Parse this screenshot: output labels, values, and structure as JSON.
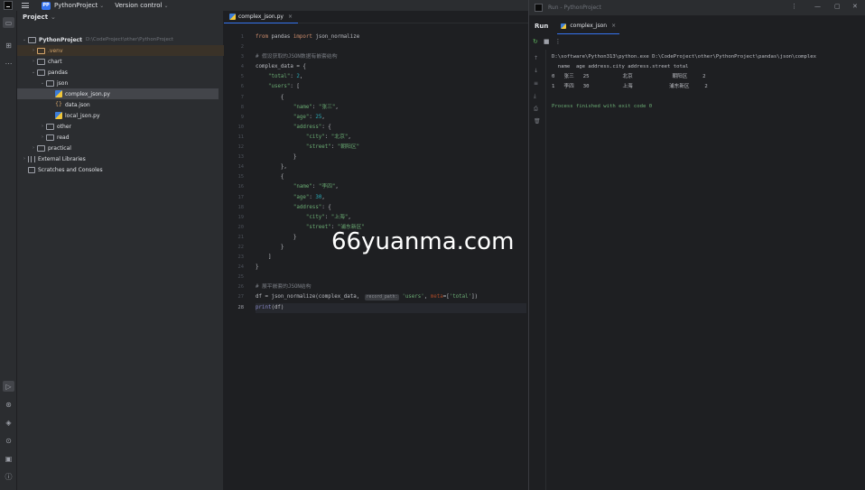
{
  "titlebar": {
    "project_badge": "PP",
    "project_name": "PythonProject",
    "vcs_label": "Version control"
  },
  "project_panel": {
    "header": "Project",
    "items": [
      {
        "label": "PythonProject",
        "hint": "D:\\CodeProject\\other\\PythonProject"
      },
      {
        "label": ".venv"
      },
      {
        "label": "chart"
      },
      {
        "label": "pandas"
      },
      {
        "label": "json"
      },
      {
        "label": "complex_json.py"
      },
      {
        "label": "data.json"
      },
      {
        "label": "local_json.py"
      },
      {
        "label": "other"
      },
      {
        "label": "read"
      },
      {
        "label": "practical"
      },
      {
        "label": "External Libraries"
      },
      {
        "label": "Scratches and Consoles"
      }
    ]
  },
  "editor": {
    "tab_label": "complex_json.py",
    "line_numbers": [
      "1",
      "2",
      "3",
      "4",
      "5",
      "6",
      "7",
      "8",
      "9",
      "10",
      "11",
      "12",
      "13",
      "14",
      "15",
      "16",
      "17",
      "18",
      "19",
      "20",
      "21",
      "22",
      "23",
      "24",
      "25",
      "26",
      "27",
      "28"
    ],
    "param_hint": "record_path:",
    "code": {
      "l1_kw1": "from",
      "l1_mod": " pandas ",
      "l1_kw2": "import",
      "l1_name": " json_normalize",
      "l3": "# 假设获取的JSON数据有嵌套结构",
      "l4": "complex_data = {",
      "l5_key": "\"total\"",
      "l5_sep": ": ",
      "l5_val": "2",
      "l5_end": ",",
      "l6_key": "\"users\"",
      "l6_rest": ": [",
      "l7": "{",
      "l8_key": "\"name\"",
      "l8_sep": ": ",
      "l8_val": "\"张三\"",
      "l8_end": ",",
      "l9_key": "\"age\"",
      "l9_sep": ": ",
      "l9_val": "25",
      "l9_end": ",",
      "l10_key": "\"address\"",
      "l10_rest": ": {",
      "l11_key": "\"city\"",
      "l11_sep": ": ",
      "l11_val": "\"北京\"",
      "l11_end": ",",
      "l12_key": "\"street\"",
      "l12_sep": ": ",
      "l12_val": "\"朝阳区\"",
      "l13": "}",
      "l14": "},",
      "l15": "{",
      "l16_key": "\"name\"",
      "l16_sep": ": ",
      "l16_val": "\"李四\"",
      "l16_end": ",",
      "l17_key": "\"age\"",
      "l17_sep": ": ",
      "l17_val": "30",
      "l17_end": ",",
      "l18_key": "\"address\"",
      "l18_rest": ": {",
      "l19_key": "\"city\"",
      "l19_sep": ": ",
      "l19_val": "\"上海\"",
      "l19_end": ",",
      "l20_key": "\"street\"",
      "l20_sep": ": ",
      "l20_val": "\"浦东新区\"",
      "l21": "}",
      "l22": "}",
      "l23": "]",
      "l24": "}",
      "l26": "# 展平嵌套的JSON结构",
      "l27_a": "df = json_normalize(complex_data, ",
      "l27_b": "'users'",
      "l27_c": ", ",
      "l27_d": "meta",
      "l27_e": "=[",
      "l27_f": "'total'",
      "l27_g": "])",
      "l28_a": "print",
      "l28_b": "(df)"
    }
  },
  "watermark": "66yuanma.com",
  "run_window": {
    "title": "Run - PythonProject",
    "tool_label": "Run",
    "tab_label": "complex_json",
    "console": [
      "D:\\software\\Python313\\python.exe D:\\CodeProject\\other\\PythonProject\\pandas\\json\\complex",
      "  name  age address.city address.street total",
      "0   张三   25           北京             朝阳区     2",
      "1   李四   30           上海            浦东新区     2",
      "",
      "Process finished with exit code 0"
    ]
  }
}
